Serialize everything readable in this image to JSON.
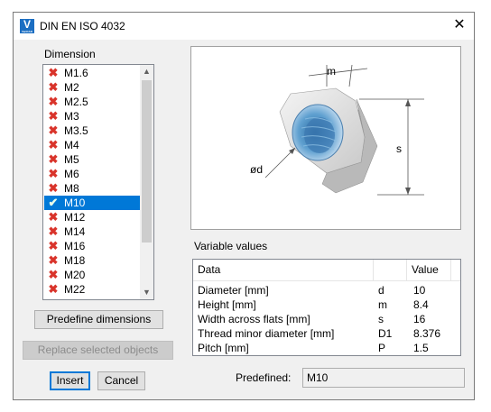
{
  "window": {
    "title": "DIN EN ISO 4032",
    "app_icon_letter": "V",
    "app_icon_caption": "VariCAD",
    "close_icon": "close-icon"
  },
  "dimension": {
    "label": "Dimension",
    "items": [
      {
        "label": "M1.6",
        "status": "unavailable"
      },
      {
        "label": "M2",
        "status": "unavailable"
      },
      {
        "label": "M2.5",
        "status": "unavailable"
      },
      {
        "label": "M3",
        "status": "unavailable"
      },
      {
        "label": "M3.5",
        "status": "unavailable"
      },
      {
        "label": "M4",
        "status": "unavailable"
      },
      {
        "label": "M5",
        "status": "unavailable"
      },
      {
        "label": "M6",
        "status": "unavailable"
      },
      {
        "label": "M8",
        "status": "unavailable"
      },
      {
        "label": "M10",
        "status": "available"
      },
      {
        "label": "M12",
        "status": "unavailable"
      },
      {
        "label": "M14",
        "status": "unavailable"
      },
      {
        "label": "M16",
        "status": "unavailable"
      },
      {
        "label": "M18",
        "status": "unavailable"
      },
      {
        "label": "M20",
        "status": "unavailable"
      },
      {
        "label": "M22",
        "status": "unavailable"
      }
    ],
    "selected": "M10"
  },
  "buttons": {
    "predefine": "Predefine dimensions",
    "replace": "Replace selected objects",
    "insert": "Insert",
    "cancel": "Cancel"
  },
  "drawing": {
    "labels": {
      "m": "m",
      "d": "ød",
      "s": "s"
    }
  },
  "variables": {
    "label": "Variable values",
    "headers": {
      "data": "Data",
      "symbol": "",
      "value": "Value"
    },
    "rows": [
      {
        "data": "Diameter [mm]",
        "symbol": "d",
        "value": "10"
      },
      {
        "data": "Height [mm]",
        "symbol": "m",
        "value": "8.4"
      },
      {
        "data": "Width across flats [mm]",
        "symbol": "s",
        "value": "16"
      },
      {
        "data": "Thread minor diameter [mm]",
        "symbol": "D1",
        "value": "8.376"
      },
      {
        "data": "Pitch [mm]",
        "symbol": "P",
        "value": "1.5"
      }
    ]
  },
  "predefined": {
    "label": "Predefined:",
    "value": "M10"
  },
  "colors": {
    "selection": "#0078d7",
    "cross": "#d9342b",
    "check": "#3aa64a"
  }
}
